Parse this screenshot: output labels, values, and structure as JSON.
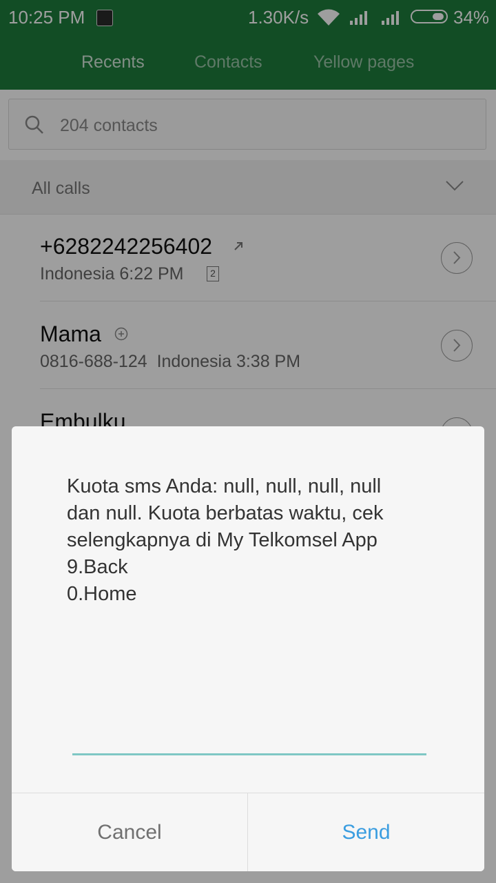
{
  "status_bar": {
    "time": "10:25 PM",
    "net_speed": "1.30K/s",
    "battery_pct": "34%",
    "battery_level": 0.34
  },
  "tabs": [
    {
      "label": "Recents",
      "active": true
    },
    {
      "label": "Contacts",
      "active": false
    },
    {
      "label": "Yellow pages",
      "active": false
    }
  ],
  "search": {
    "placeholder": "204 contacts"
  },
  "filter": {
    "label": "All calls"
  },
  "calls": [
    {
      "name": "+6282242256402",
      "sub": "Indonesia 6:22 PM",
      "sim": "2"
    },
    {
      "name": "Mama",
      "sub": "0816-688-124  Indonesia 3:38 PM"
    },
    {
      "name": "Embulku",
      "sub": ""
    }
  ],
  "dialog": {
    "message_lines": [
      "Kuota sms Anda: null, null, null, null",
      "dan null. Kuota berbatas waktu, cek",
      "selengkapnya di My Telkomsel App",
      "9.Back",
      "0.Home"
    ],
    "reply_value": "",
    "cancel_label": "Cancel",
    "send_label": "Send"
  },
  "colors": {
    "brand_green": "#1e7d3d",
    "send_blue": "#3a9de0",
    "input_underline": "#7fc7c4"
  }
}
